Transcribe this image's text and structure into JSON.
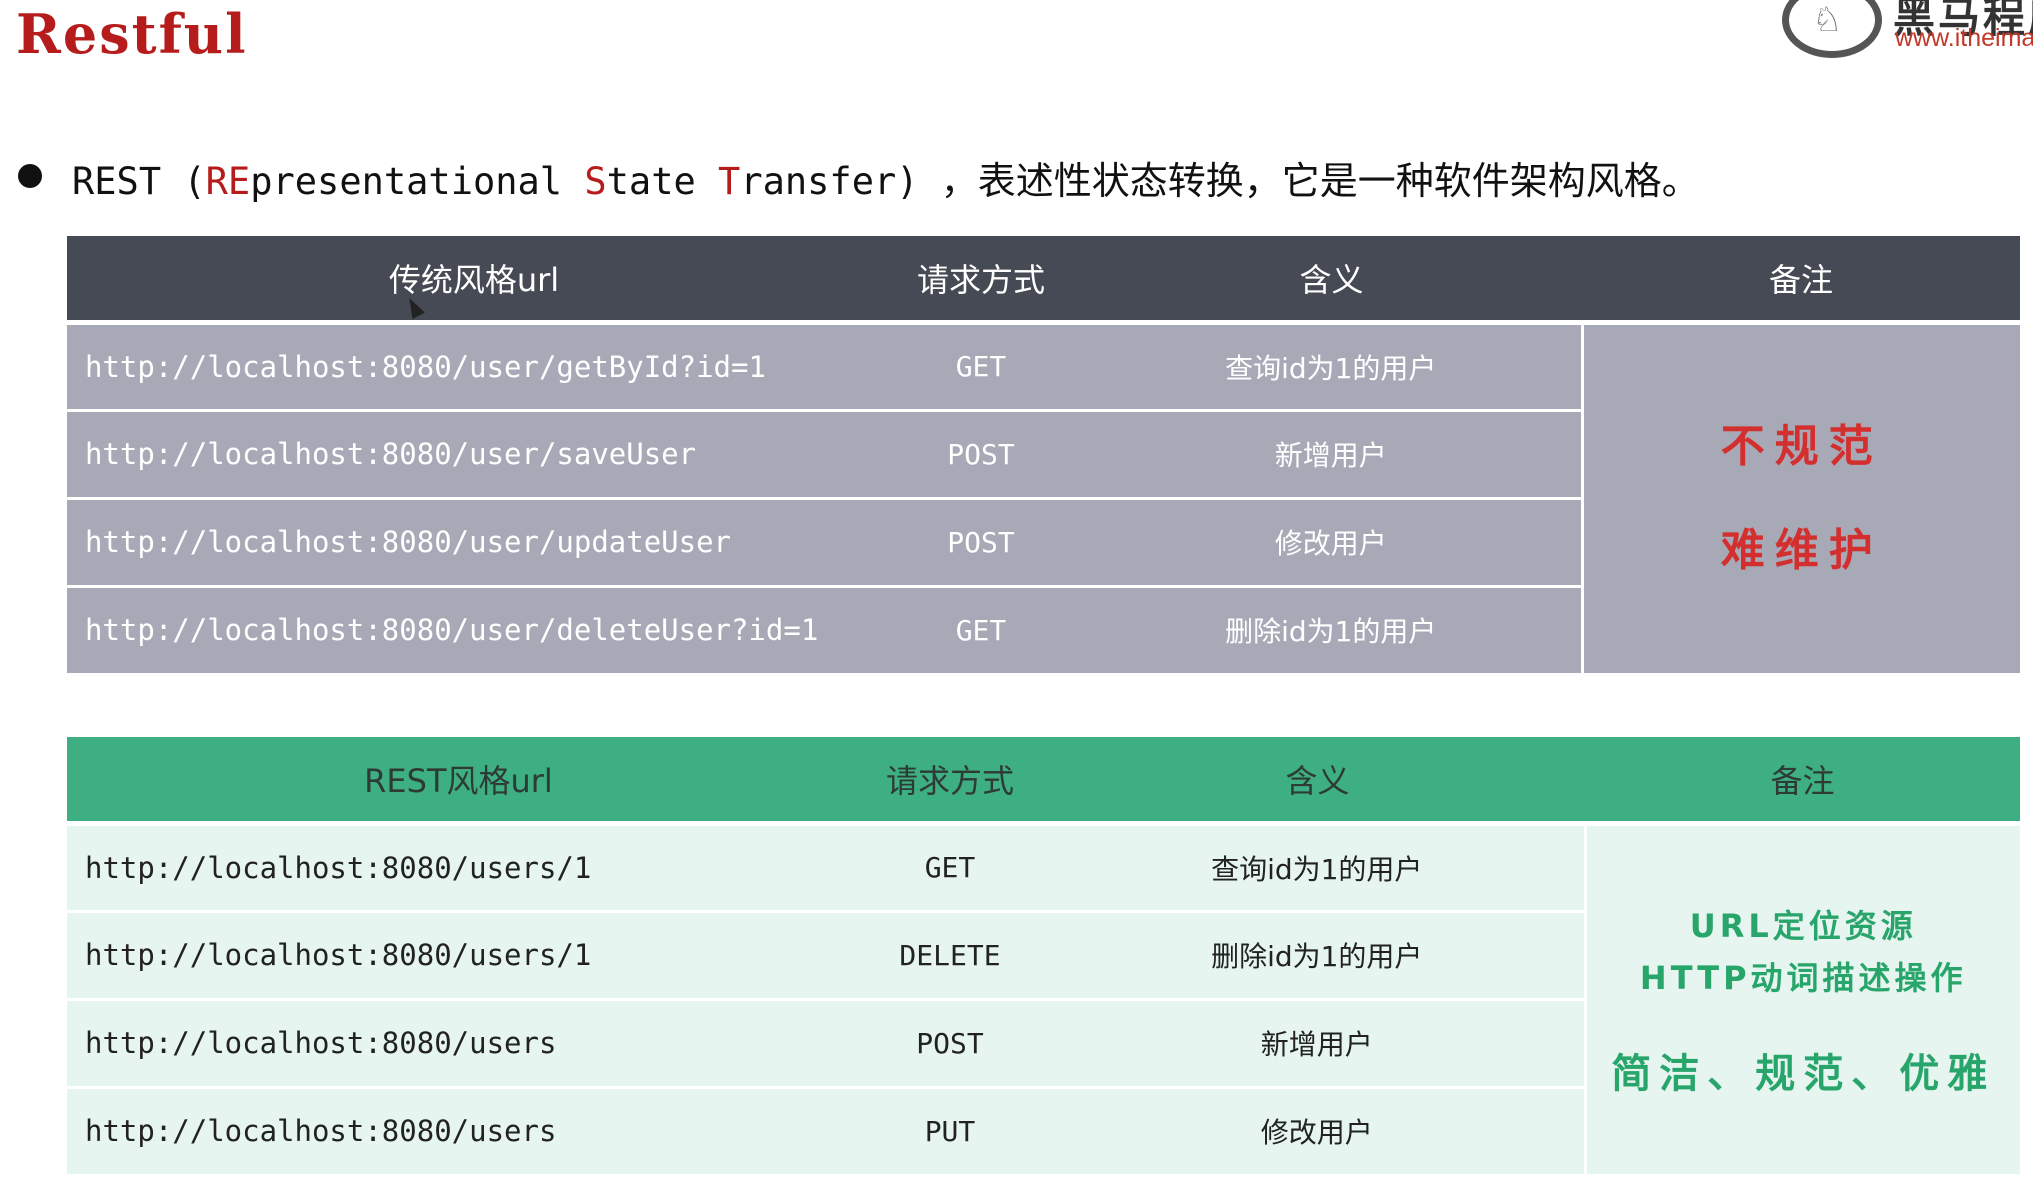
{
  "title": "Restful",
  "brand": {
    "name_cn": "黑马程序",
    "url": "www.itheima"
  },
  "intro": {
    "prefix": "REST (",
    "re_red": "RE",
    "part1": "presentational ",
    "s_red": "S",
    "part2": "tate ",
    "t_red": "T",
    "part3": "ransfer) ，",
    "description": "表述性状态转换，它是一种软件架构风格。"
  },
  "traditional_table": {
    "headers": [
      "传统风格url",
      "请求方式",
      "含义",
      "备注"
    ],
    "rows": [
      {
        "url": "http://localhost:8080/user/getById?id=1",
        "method": "GET",
        "meaning": "查询id为1的用户"
      },
      {
        "url": "http://localhost:8080/user/saveUser",
        "method": "POST",
        "meaning": "新增用户"
      },
      {
        "url": "http://localhost:8080/user/updateUser",
        "method": "POST",
        "meaning": "修改用户"
      },
      {
        "url": "http://localhost:8080/user/deleteUser?id=1",
        "method": "GET",
        "meaning": "删除id为1的用户"
      }
    ],
    "note_line1": "不规范",
    "note_line2": "难维护"
  },
  "rest_table": {
    "headers": [
      "REST风格url",
      "请求方式",
      "含义",
      "备注"
    ],
    "rows": [
      {
        "url": "http://localhost:8080/users/1",
        "method": "GET",
        "meaning": "查询id为1的用户"
      },
      {
        "url": "http://localhost:8080/users/1",
        "method": "DELETE",
        "meaning": "删除id为1的用户"
      },
      {
        "url": "http://localhost:8080/users",
        "method": "POST",
        "meaning": "新增用户"
      },
      {
        "url": "http://localhost:8080/users",
        "method": "PUT",
        "meaning": "修改用户"
      }
    ],
    "note_line1": "URL定位资源",
    "note_line2": "HTTP动词描述操作",
    "note_line3": "简洁、规范、优雅"
  },
  "colors": {
    "title": "#b71c1c",
    "traditional_header": "#464a55",
    "traditional_body": "#a7a9b6",
    "traditional_note": "#d32f2f",
    "rest_header": "#3daf82",
    "rest_body": "#e6f5ef",
    "rest_note": "#27a56b"
  }
}
